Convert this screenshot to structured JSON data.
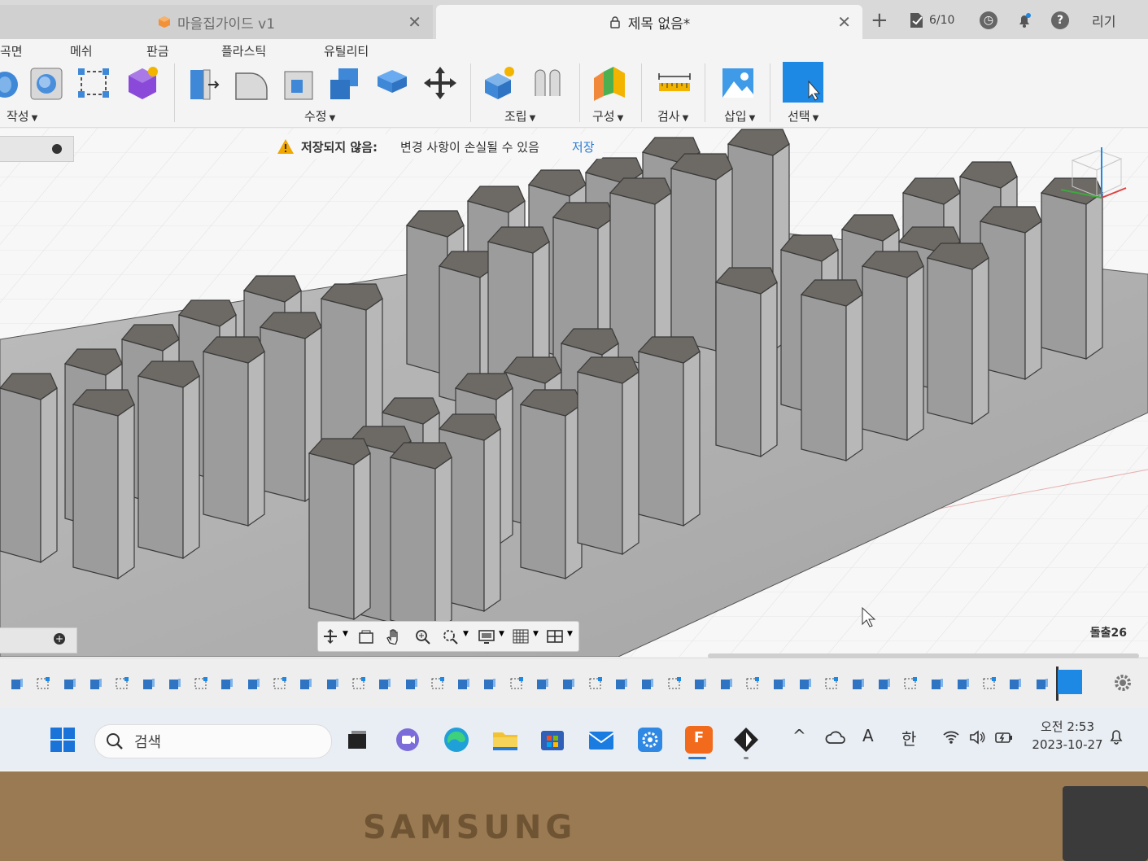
{
  "tabs": {
    "inactive_title": "마을집가이드 v1",
    "active_title": "제목 없음*",
    "job_status": "6/10",
    "right_label": "리기"
  },
  "toolbar": {
    "menu_tabs": [
      "곡면",
      "메쉬",
      "판금",
      "플라스틱",
      "유틸리티"
    ],
    "groups": {
      "create": "작성",
      "modify": "수정",
      "assemble": "조립",
      "construct": "구성",
      "inspect": "검사",
      "insert": "삽입",
      "select": "선택"
    }
  },
  "banner": {
    "title": "저장되지 않음:",
    "message": "변경 사항이 손실될 수 있음",
    "save_link": "저장"
  },
  "viewport": {
    "corner_label": "돌출26"
  },
  "taskbar": {
    "search_placeholder": "검색",
    "ime_a": "A",
    "ime_han": "한",
    "time": "오전 2:53",
    "date": "2023-10-27"
  },
  "bezel": {
    "brand": "SAMSUNG"
  },
  "colors": {
    "accent": "#1e88e5",
    "warning": "#f2a600",
    "link": "#2a7bd4",
    "fusion_orange": "#f26b1d"
  }
}
